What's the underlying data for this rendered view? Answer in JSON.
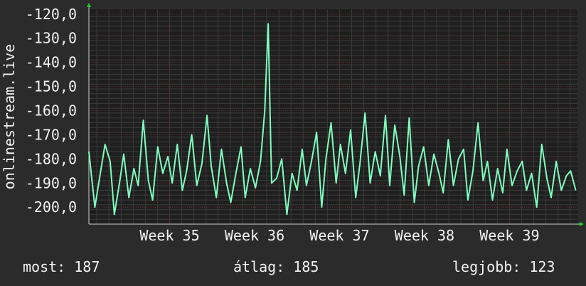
{
  "chart_data": {
    "type": "line",
    "ylabel": "onlinestream.live",
    "ylim": [
      -207,
      -118
    ],
    "yticks": [
      "-120,0",
      "-130,0",
      "-140,0",
      "-150,0",
      "-160,0",
      "-170,0",
      "-180,0",
      "-190,0",
      "-200,0"
    ],
    "ytick_values": [
      -120,
      -130,
      -140,
      -150,
      -160,
      -170,
      -180,
      -190,
      -200
    ],
    "xlim": [
      34.05,
      39.8
    ],
    "xticks": [
      "Week 35",
      "Week 36",
      "Week 37",
      "Week 38",
      "Week 39"
    ],
    "xtick_values": [
      35,
      36,
      37,
      38,
      39
    ],
    "grid": true,
    "line_color": "#7fffc0",
    "series": [
      {
        "x": [
          34.05,
          34.12,
          34.18,
          34.24,
          34.3,
          34.35,
          34.41,
          34.46,
          34.52,
          34.58,
          34.63,
          34.69,
          34.75,
          34.8,
          34.86,
          34.92,
          34.98,
          35.03,
          35.09,
          35.15,
          35.2,
          35.26,
          35.32,
          35.38,
          35.44,
          35.49,
          35.55,
          35.61,
          35.67,
          35.72,
          35.78,
          35.84,
          35.89,
          35.95,
          36.01,
          36.07,
          36.12,
          36.16,
          36.2,
          36.26,
          36.32,
          36.38,
          36.44,
          36.5,
          36.56,
          36.61,
          36.67,
          36.73,
          36.79,
          36.84,
          36.9,
          36.96,
          37.01,
          37.07,
          37.13,
          37.19,
          37.24,
          37.3,
          37.36,
          37.42,
          37.48,
          37.54,
          37.59,
          37.65,
          37.71,
          37.76,
          37.82,
          37.88,
          37.93,
          37.99,
          38.05,
          38.11,
          38.17,
          38.22,
          38.28,
          38.34,
          38.4,
          38.46,
          38.51,
          38.57,
          38.63,
          38.69,
          38.74,
          38.8,
          38.86,
          38.92,
          38.97,
          39.03,
          39.09,
          39.15,
          39.2,
          39.26,
          39.32,
          39.38,
          39.44,
          39.49,
          39.55,
          39.61,
          39.67,
          39.72,
          39.78
        ],
        "values": [
          -177,
          -200,
          -187,
          -174,
          -181,
          -203,
          -190,
          -178,
          -196,
          -184,
          -191,
          -164,
          -189,
          -197,
          -175,
          -186,
          -179,
          -190,
          -174,
          -193,
          -185,
          -170,
          -191,
          -182,
          -162,
          -183,
          -196,
          -176,
          -190,
          -198,
          -186,
          -175,
          -196,
          -184,
          -192,
          -181,
          -160,
          -124,
          -190,
          -188,
          -180,
          -203,
          -186,
          -193,
          -176,
          -191,
          -181,
          -169,
          -200,
          -180,
          -165,
          -190,
          -174,
          -186,
          -168,
          -196,
          -182,
          -161,
          -190,
          -177,
          -187,
          -162,
          -191,
          -166,
          -179,
          -195,
          -163,
          -198,
          -183,
          -175,
          -191,
          -178,
          -186,
          -194,
          -172,
          -191,
          -180,
          -176,
          -197,
          -185,
          -165,
          -189,
          -181,
          -197,
          -184,
          -194,
          -176,
          -191,
          -185,
          -181,
          -193,
          -186,
          -200,
          -174,
          -188,
          -196,
          -181,
          -193,
          -187,
          -185,
          -193
        ]
      }
    ]
  },
  "stats": {
    "now": "most: 187",
    "avg": "átlag: 185",
    "best": "legjobb: 123"
  }
}
